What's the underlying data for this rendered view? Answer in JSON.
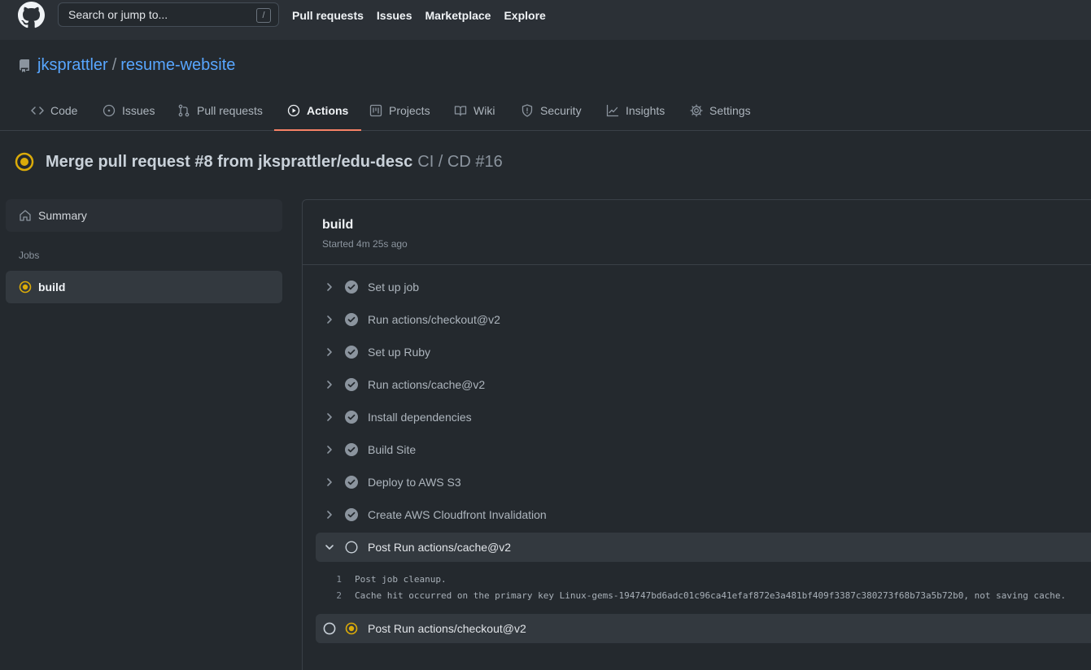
{
  "header": {
    "search_placeholder": "Search or jump to...",
    "search_shortcut": "/",
    "nav": [
      "Pull requests",
      "Issues",
      "Marketplace",
      "Explore"
    ]
  },
  "repo": {
    "owner": "jksprattler",
    "separator": "/",
    "name": "resume-website"
  },
  "tabs": [
    {
      "label": "Code",
      "icon": "code-icon"
    },
    {
      "label": "Issues",
      "icon": "issue-icon"
    },
    {
      "label": "Pull requests",
      "icon": "pull-request-icon"
    },
    {
      "label": "Actions",
      "icon": "play-icon",
      "active": true
    },
    {
      "label": "Projects",
      "icon": "project-icon"
    },
    {
      "label": "Wiki",
      "icon": "book-icon"
    },
    {
      "label": "Security",
      "icon": "shield-icon"
    },
    {
      "label": "Insights",
      "icon": "graph-icon"
    },
    {
      "label": "Settings",
      "icon": "gear-icon"
    }
  ],
  "run": {
    "title": "Merge pull request #8 from jksprattler/edu-desc",
    "workflow": "CI / CD #16",
    "status_color": "#dbab09"
  },
  "sidebar": {
    "summary_label": "Summary",
    "jobs_label": "Jobs",
    "job_label": "build"
  },
  "job": {
    "name": "build",
    "started": "Started 4m 25s ago"
  },
  "steps": [
    {
      "label": "Set up job",
      "status": "success"
    },
    {
      "label": "Run actions/checkout@v2",
      "status": "success"
    },
    {
      "label": "Set up Ruby",
      "status": "success"
    },
    {
      "label": "Run actions/cache@v2",
      "status": "success"
    },
    {
      "label": "Install dependencies",
      "status": "success"
    },
    {
      "label": "Build Site",
      "status": "success"
    },
    {
      "label": "Deploy to AWS S3",
      "status": "success"
    },
    {
      "label": "Create AWS Cloudfront Invalidation",
      "status": "success"
    },
    {
      "label": "Post Run actions/cache@v2",
      "status": "pending",
      "expanded": true
    },
    {
      "label": "Post Run actions/checkout@v2",
      "status": "in-progress"
    }
  ],
  "log": [
    {
      "n": "1",
      "text": "Post job cleanup."
    },
    {
      "n": "2",
      "text": "Cache hit occurred on the primary key Linux-gems-194747bd6adc01c96ca41efaf872e3a481bf409f3387c380273f68b73a5b72b0, not saving cache."
    }
  ],
  "colors": {
    "accent": "#58a6ff",
    "tab_underline": "#f78166",
    "success": "#8b949e",
    "running": "#dbab09"
  }
}
